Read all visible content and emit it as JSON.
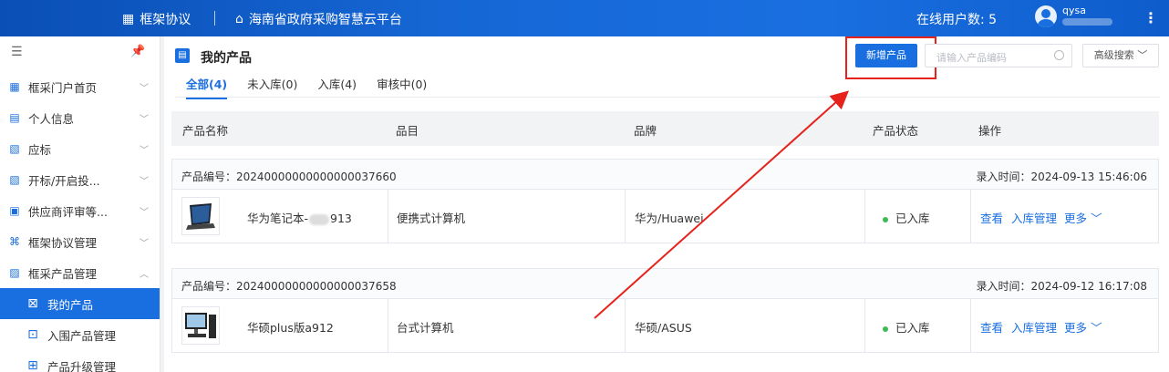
{
  "topbar": {
    "brand": "框架协议",
    "platform": "海南省政府采购智慧云平台",
    "online_label": "在线用户数: 5",
    "username": "qysa"
  },
  "sidebar": {
    "items": [
      {
        "label": "框采门户首页",
        "icon": "grid-icon"
      },
      {
        "label": "个人信息",
        "icon": "id-card-icon"
      },
      {
        "label": "应标",
        "icon": "document-icon"
      },
      {
        "label": "开标/开启投...",
        "icon": "document-icon"
      },
      {
        "label": "供应商评审等...",
        "icon": "monitor-icon"
      },
      {
        "label": "框架协议管理",
        "icon": "agreement-icon"
      },
      {
        "label": "框采产品管理",
        "icon": "product-icon"
      }
    ],
    "sub_items": [
      {
        "label": "我的产品",
        "icon": "my-product-icon",
        "active": true
      },
      {
        "label": "入围产品管理",
        "icon": "shortlist-icon",
        "active": false
      },
      {
        "label": "产品升级管理",
        "icon": "upgrade-icon",
        "active": false
      }
    ]
  },
  "main": {
    "title": "我的产品",
    "tabs": [
      "全部(4)",
      "未入库(0)",
      "入库(4)",
      "审核中(0)"
    ],
    "new_button": "新增产品",
    "search_placeholder": "请输入产品编码",
    "advanced_search": "高级搜索",
    "columns": [
      "产品名称",
      "品目",
      "品牌",
      "产品状态",
      "操作"
    ],
    "products": [
      {
        "code": "产品编号：20240000000000000037660",
        "time": "录入时间：2024-09-13 15:46:06",
        "name_prefix": "华为笔记本-",
        "name_suffix": "913",
        "category": "便携式计算机",
        "brand": "华为/Huawei",
        "status": "已入库",
        "actions": [
          "查看",
          "入库管理",
          "更多"
        ]
      },
      {
        "code": "产品编号：20240000000000000037658",
        "time": "录入时间：2024-09-12 16:17:08",
        "name_prefix": "华硕plus版a912",
        "name_suffix": "",
        "category": "台式计算机",
        "brand": "华硕/ASUS",
        "status": "已入库",
        "actions": [
          "查看",
          "入库管理",
          "更多"
        ]
      }
    ]
  },
  "colors": {
    "primary": "#1a6fe0",
    "highlight_red": "#e5231c",
    "status_green": "#3cba54"
  }
}
